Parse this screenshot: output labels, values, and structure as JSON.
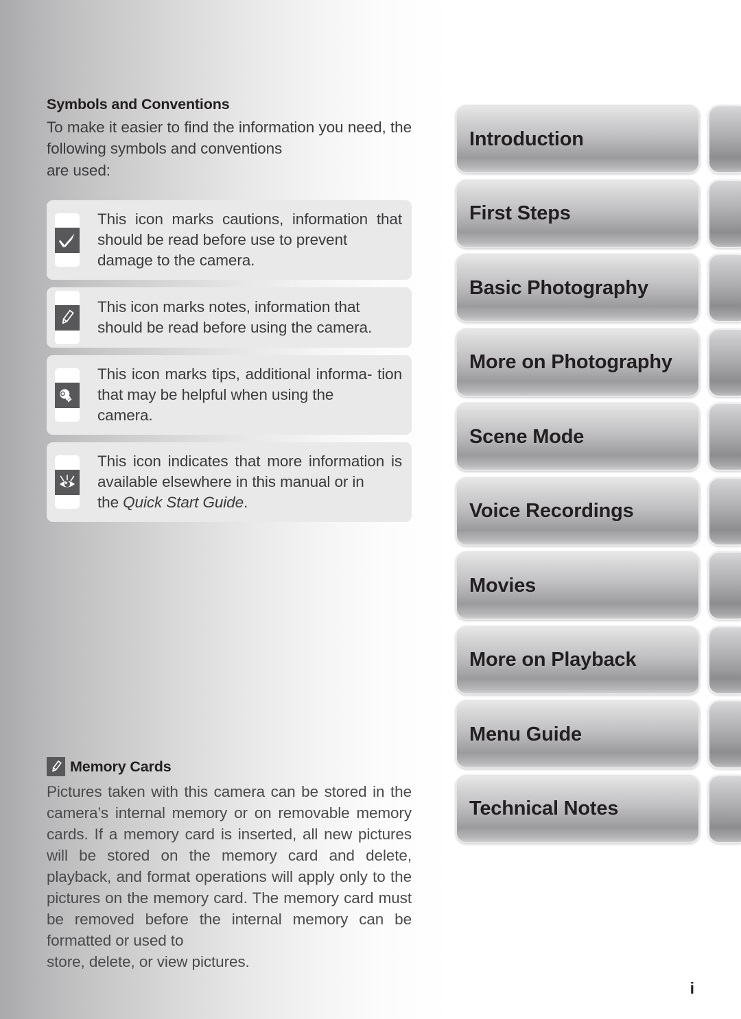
{
  "page": {
    "number": "i"
  },
  "content": {
    "heading": "Symbols and Conventions",
    "intro_line1": "To make it easier to find the information you",
    "intro_line2": "need, the following symbols and conventions",
    "intro_line3": "are used:"
  },
  "info_boxes": [
    {
      "icon": "checkmark-icon",
      "line1": "This icon marks cautions, information",
      "line2": "that should be read before use to prevent",
      "line3": "damage to the camera."
    },
    {
      "icon": "pencil-icon",
      "line1": "This icon marks notes, information that",
      "line2": "should be read before using the camera."
    },
    {
      "icon": "lightbulb-icon",
      "line1": "This icon marks tips, additional informa-",
      "line2": "tion that may be helpful when using the",
      "line3": "camera."
    },
    {
      "icon": "eye-icon",
      "line1": "This icon indicates that more information",
      "line2": "is available elsewhere in this manual or in",
      "line3_prefix": "the ",
      "line3_italic": "Quick Start Guide",
      "line3_suffix": "."
    }
  ],
  "memory_section": {
    "icon": "pencil-icon",
    "heading": "Memory Cards",
    "line1": "Pictures taken with this camera can be stored in",
    "line2": "the camera’s internal memory or on removable",
    "line3": "memory cards.  If a memory card is inserted, all",
    "line4": "new pictures will be stored on the memory card",
    "line5": "and delete, playback, and format operations will",
    "line6": "apply only to the pictures on the memory card.",
    "line7": "The memory card must be removed before the",
    "line8": "internal memory can be formatted or used to",
    "line9": "store, delete, or view pictures."
  },
  "tabs": [
    {
      "label": "Introduction"
    },
    {
      "label": "First Steps"
    },
    {
      "label": "Basic Photography"
    },
    {
      "label": "More on Photography"
    },
    {
      "label": "Scene Mode"
    },
    {
      "label": "Voice Recordings"
    },
    {
      "label": "Movies"
    },
    {
      "label": "More on Playback"
    },
    {
      "label": "Menu Guide"
    },
    {
      "label": "Technical Notes"
    }
  ],
  "colors": {
    "text": "#3b3b3d",
    "heading": "#231f20",
    "icon_square": "#58585a",
    "info_box_bg": "#e9e9e9"
  }
}
